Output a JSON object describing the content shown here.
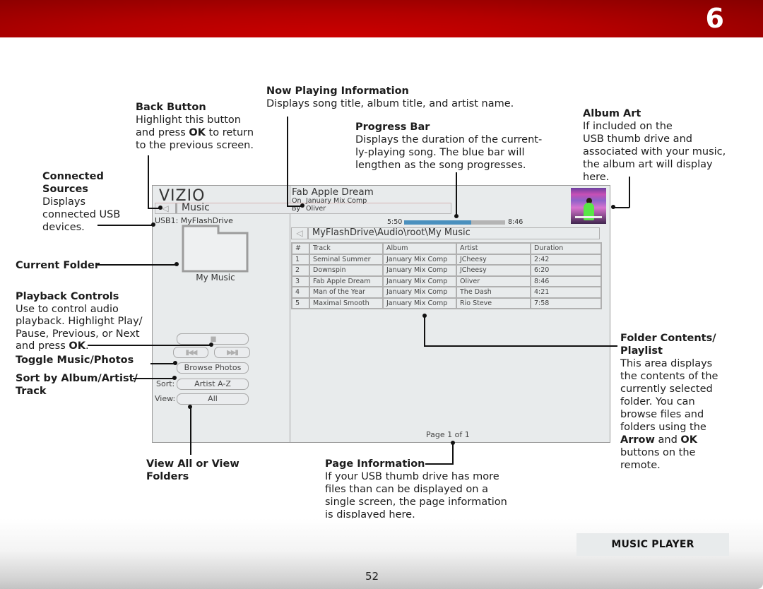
{
  "header": {
    "chapter_number": "6"
  },
  "callouts": {
    "now_playing": {
      "title": "Now Playing Information",
      "body": "Displays song title, album title, and artist name."
    },
    "back_button": {
      "title": "Back Button",
      "line1": "Highlight this button",
      "line2_pre": "and press ",
      "line2_bold": "OK",
      "line2_post": " to return",
      "line3": "to the previous screen."
    },
    "progress_bar": {
      "title": "Progress Bar",
      "line1": "Displays the duration of the current-",
      "line2": "ly-playing song. The blue bar will",
      "line3": "lengthen as the song progresses."
    },
    "album_art": {
      "title": "Album Art",
      "line1": "If included on the",
      "line2": "USB thumb drive and",
      "line3": "associated with your music,",
      "line4": "the album art will display",
      "line5": "here."
    },
    "connected_sources": {
      "title1": "Connected",
      "title2": "Sources",
      "line1": "Displays",
      "line2": "connected USB",
      "line3": "devices."
    },
    "current_folder": {
      "title": "Current Folder"
    },
    "playback_controls": {
      "title": "Playback Controls",
      "line1": "Use to control audio",
      "line2": "playback. Highlight Play/",
      "line3": "Pause, Previous, or Next",
      "line4_pre": "and press ",
      "line4_bold": "OK",
      "line4_post": "."
    },
    "toggle": {
      "title": "Toggle Music/Photos"
    },
    "sort": {
      "title1": "Sort by Album/Artist/",
      "title2": "Track"
    },
    "view": {
      "title1": "View All or View",
      "title2": "Folders"
    },
    "page_info": {
      "title": "Page Information",
      "line1": "If your USB thumb drive has more",
      "line2": "files than can be displayed on a",
      "line3": "single screen, the page information",
      "line4": "is displayed here."
    },
    "folder_contents": {
      "title1": "Folder Contents/",
      "title2": "Playlist",
      "line1": "This area displays",
      "line2": "the contents of the",
      "line3": "currently selected",
      "line4": "folder. You can",
      "line5": "browse files and",
      "line6": "folders using the",
      "line7_b1": "Arrow",
      "line7_mid": " and ",
      "line7_b2": "OK",
      "line8": "buttons on the",
      "line9": "remote."
    }
  },
  "tv": {
    "logo": "VIZIO",
    "back_glyph": "◁",
    "breadcrumb": "Music",
    "source": "USB1: MyFlashDrive",
    "folder_name": "My Music",
    "controls": {
      "play_pause_glyph": "▮▮",
      "previous_glyph": "▮◀◀",
      "next_glyph": "▶▶▮",
      "browse_label": "Browse Photos",
      "sort_label": "Sort:",
      "sort_value": "Artist A-Z",
      "view_label": "View:",
      "view_value": "All"
    },
    "now_playing": {
      "title": "Fab Apple Dream",
      "on_label": "On",
      "album": "January Mix Comp",
      "by_label": "By",
      "artist": "Oliver",
      "elapsed": "5:50",
      "total": "8:46",
      "progress_fraction": 0.665
    },
    "path": "MyFlashDrive\\Audio\\root\\My Music",
    "table": {
      "headers": [
        "#",
        "Track",
        "Album",
        "Artist",
        "Duration"
      ],
      "rows": [
        [
          "1",
          "Seminal Summer",
          "January Mix Comp",
          "JCheesy",
          "2:42"
        ],
        [
          "2",
          "Downspin",
          "January Mix Comp",
          "JCheesy",
          "6:20"
        ],
        [
          "3",
          "Fab Apple Dream",
          "January Mix Comp",
          "Oliver",
          "8:46"
        ],
        [
          "4",
          "Man of the Year",
          "January Mix Comp",
          "The Dash",
          "4:21"
        ],
        [
          "5",
          "Maximal Smooth",
          "January Mix Comp",
          "Rio Steve",
          "7:58"
        ]
      ]
    },
    "page_info": "Page 1 of 1"
  },
  "footer": {
    "section": "MUSIC PLAYER",
    "page_number": "52"
  },
  "colors": {
    "brand_red": "#c00000",
    "progress_blue": "#4a90be"
  }
}
